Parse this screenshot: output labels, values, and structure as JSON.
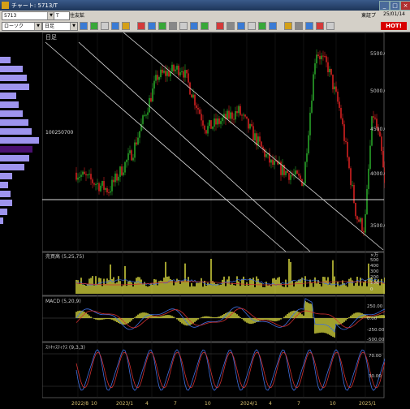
{
  "window": {
    "title": "チャート: 5713/T",
    "min_label": "_",
    "max_label": "□",
    "close_label": "×"
  },
  "toolbar": {
    "symbol_input": "5713",
    "exchange_label": "T",
    "stock_name": "住友鉱",
    "market": "東証プ",
    "date": "25/01/14",
    "hot_label": "HOT!",
    "chart_style": "ローソク",
    "period": "日足"
  },
  "price_panel": {
    "period_label": "日足",
    "marker_label": "100250700",
    "y_ticks": [
      "5500.0",
      "5000.0",
      "4500.0",
      "4000.0",
      "3500.0"
    ]
  },
  "volume_panel": {
    "label": "売買高 (5,25,75)",
    "y_ticks": [
      "×万",
      "500",
      "400",
      "300",
      "200",
      "100",
      "0"
    ]
  },
  "macd_panel": {
    "label": "MACD (5,20,9)",
    "y_ticks": [
      "250.00",
      "0.00",
      "-250.00",
      "-500.00"
    ]
  },
  "stoch_panel": {
    "label": "ｽﾄｷｬｽﾃｨｸｽ (9,3,3)",
    "y_ticks": [
      "70.00",
      "30.00"
    ]
  },
  "x_axis": [
    "2022/8",
    "10",
    "2023/1",
    "4",
    "7",
    "10",
    "2024/1",
    "4",
    "7",
    "10",
    "2025/1"
  ],
  "volume_profile": [
    0.25,
    0.55,
    0.65,
    0.72,
    0.4,
    0.45,
    0.55,
    0.7,
    0.78,
    0.95,
    0.8,
    0.72,
    0.6,
    0.3,
    0.2,
    0.25,
    0.3,
    0.18,
    0.08
  ],
  "colors": {
    "up": "#29a329",
    "down": "#d42020",
    "volume": "#c8c83a",
    "ma_short": "#3f6fe0",
    "ma_long": "#d03030",
    "profile": "#9e94ee",
    "profile_highlight": "#4a1070"
  }
}
